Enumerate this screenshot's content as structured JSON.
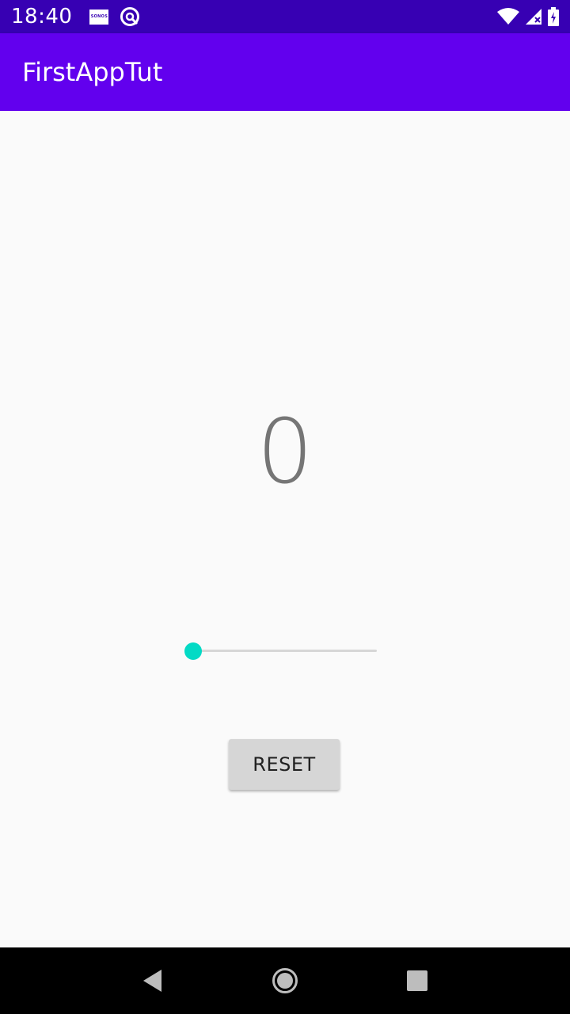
{
  "status_bar": {
    "time": "18:40",
    "left_icons": [
      "sonos-icon",
      "at-icon"
    ],
    "sonos_text": "SONOS",
    "right_icons": [
      "wifi-icon",
      "signal-icon",
      "battery-icon"
    ]
  },
  "app_bar": {
    "title": "FirstAppTut",
    "color": "#6200ee",
    "status_color": "#3700b3"
  },
  "main": {
    "counter_value": "0",
    "slider": {
      "value": 0,
      "accent_color": "#03dac5"
    },
    "reset_label": "RESET"
  },
  "nav_bar": {
    "buttons": [
      "back-icon",
      "home-icon",
      "recents-icon"
    ]
  }
}
